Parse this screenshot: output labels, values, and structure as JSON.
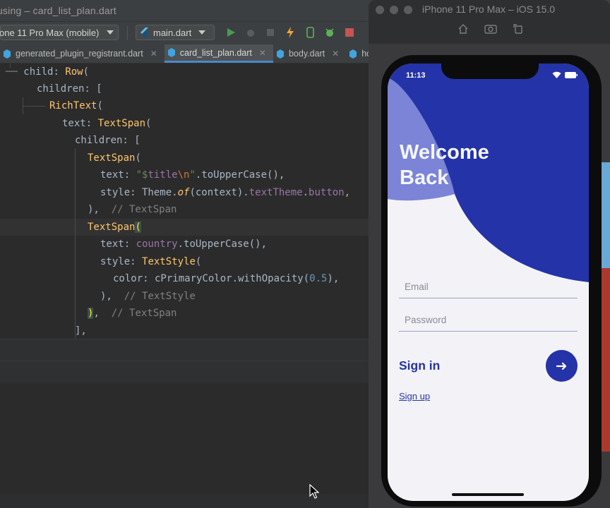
{
  "ide": {
    "title": "using – card_list_plan.dart",
    "device_selector": "one 11 Pro Max (mobile)",
    "run_config": "main.dart",
    "tabs": [
      {
        "label": "generated_plugin_registrant.dart",
        "active": false
      },
      {
        "label": "card_list_plan.dart",
        "active": true
      },
      {
        "label": "body.dart",
        "active": false
      },
      {
        "label": "ho",
        "active": false
      }
    ],
    "toolbar_icons": [
      "run-icon",
      "debug-icon",
      "profile-icon",
      "hot-reload-icon",
      "device-manager-icon",
      "flutter-inspector-icon",
      "stop-icon"
    ]
  },
  "code": {
    "l1": [
      "child: ",
      "Row",
      "("
    ],
    "l2": [
      "children: ["
    ],
    "l3": [
      "RichText",
      "("
    ],
    "l4": [
      "text: ",
      "TextSpan",
      "("
    ],
    "l5": [
      "children: ["
    ],
    "l6": [
      "TextSpan",
      "("
    ],
    "l7": [
      "text: ",
      "\"$",
      "title",
      "\\n",
      "\"",
      ".toUpperCase(),"
    ],
    "l8": [
      "style: Theme.",
      "of",
      "(context).",
      "textTheme",
      ".",
      "button",
      ","
    ],
    "l9": [
      "),",
      "  // TextSpan"
    ],
    "l10": [
      "TextSpan",
      "("
    ],
    "l11": [
      "text: ",
      "country",
      ".toUpperCase(),"
    ],
    "l12": [
      "style: ",
      "TextStyle",
      "("
    ],
    "l13": [
      "color: cPrimaryColor.withOpacity(",
      "0.5",
      "),"
    ],
    "l14": [
      "),",
      "  // TextStyle"
    ],
    "l15": [
      ")",
      ",",
      "  // TextSpan"
    ],
    "l16": [
      "],"
    ]
  },
  "simulator": {
    "window_title": "iPhone 11 Pro Max – iOS 15.0",
    "toolbar_icons": [
      "home-icon",
      "screenshot-icon",
      "rotate-icon"
    ]
  },
  "app": {
    "status_time": "11:13",
    "heading_line1": "Welcome",
    "heading_line2": "Back",
    "email_placeholder": "Email",
    "password_placeholder": "Password",
    "signin_label": "Sign in",
    "signup_link": "Sign up",
    "colors": {
      "primary": "#2433a8",
      "hero_light": "#7b84d6",
      "background": "#f3f3f7"
    }
  }
}
